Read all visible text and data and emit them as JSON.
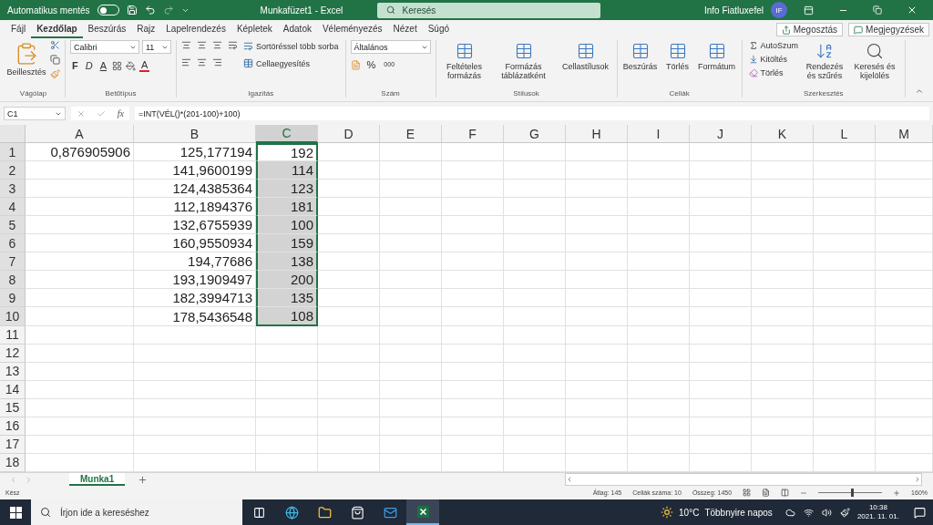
{
  "title_bar": {
    "autosave_label": "Automatikus mentés",
    "autosave_on": false,
    "file_title": "Munkafüzet1 - Excel",
    "search_placeholder": "Keresés",
    "user_name": "Info Fiatluxefel",
    "avatar_initials": "IF"
  },
  "menu_tabs": [
    {
      "label": "Fájl",
      "selected": false
    },
    {
      "label": "Kezdőlap",
      "selected": true
    },
    {
      "label": "Beszúrás",
      "selected": false
    },
    {
      "label": "Rajz",
      "selected": false
    },
    {
      "label": "Lapelrendezés",
      "selected": false
    },
    {
      "label": "Képletek",
      "selected": false
    },
    {
      "label": "Adatok",
      "selected": false
    },
    {
      "label": "Véleményezés",
      "selected": false
    },
    {
      "label": "Nézet",
      "selected": false
    },
    {
      "label": "Súgó",
      "selected": false
    }
  ],
  "share_button": "Megosztás",
  "comments_button": "Megjegyzések",
  "ribbon": {
    "clipboard": {
      "label": "Vágólap",
      "paste": "Beillesztés"
    },
    "font": {
      "label": "Betűtípus",
      "font_name": "Calibri",
      "font_size": "11",
      "bold": "F",
      "italic": "D",
      "underline": "A",
      "font_color": "A"
    },
    "alignment": {
      "label": "Igazítás",
      "wrap_text": "Sortöréssel több sorba",
      "merge": "Cellaegyesítés"
    },
    "number": {
      "label": "Szám",
      "format": "Általános",
      "percent": "%",
      "thousands": "000"
    },
    "styles": {
      "label": "Stílusok",
      "buttons": [
        "Feltételes formázás",
        "Formázás táblázatként",
        "Cellastílusok"
      ]
    },
    "cells": {
      "label": "Cellák",
      "buttons": [
        "Beszúrás",
        "Törlés",
        "Formátum"
      ]
    },
    "editing": {
      "label": "Szerkesztés",
      "autosum": "AutoSzum",
      "fill": "Kitöltés",
      "clear": "Törlés",
      "sort": "Rendezés és szűrés",
      "find": "Keresés és kijelölés"
    }
  },
  "formula_bar": {
    "name_box": "C1",
    "fx": "fx",
    "formula": "=INT(VÉL()*(201-100)+100)"
  },
  "sheet": {
    "columns": [
      {
        "label": "A",
        "selected": false
      },
      {
        "label": "B",
        "selected": false
      },
      {
        "label": "C",
        "selected": true
      },
      {
        "label": "D",
        "selected": false
      },
      {
        "label": "E",
        "selected": false
      },
      {
        "label": "F",
        "selected": false
      },
      {
        "label": "G",
        "selected": false
      },
      {
        "label": "H",
        "selected": false
      },
      {
        "label": "I",
        "selected": false
      },
      {
        "label": "J",
        "selected": false
      },
      {
        "label": "K",
        "selected": false
      },
      {
        "label": "L",
        "selected": false
      },
      {
        "label": "M",
        "selected": false
      }
    ],
    "rows": [
      {
        "label": "1",
        "selected": true,
        "cells": [
          "0,876905906",
          "125,177194",
          "192"
        ]
      },
      {
        "label": "2",
        "selected": true,
        "cells": [
          "",
          "141,9600199",
          "114"
        ]
      },
      {
        "label": "3",
        "selected": true,
        "cells": [
          "",
          "124,4385364",
          "123"
        ]
      },
      {
        "label": "4",
        "selected": true,
        "cells": [
          "",
          "112,1894376",
          "181"
        ]
      },
      {
        "label": "5",
        "selected": true,
        "cells": [
          "",
          "132,6755939",
          "100"
        ]
      },
      {
        "label": "6",
        "selected": true,
        "cells": [
          "",
          "160,9550934",
          "159"
        ]
      },
      {
        "label": "7",
        "selected": true,
        "cells": [
          "",
          "194,77686",
          "138"
        ]
      },
      {
        "label": "8",
        "selected": true,
        "cells": [
          "",
          "193,1909497",
          "200"
        ]
      },
      {
        "label": "9",
        "selected": true,
        "cells": [
          "",
          "182,3994713",
          "135"
        ]
      },
      {
        "label": "10",
        "selected": true,
        "cells": [
          "",
          "178,5436548",
          "108"
        ]
      },
      {
        "label": "11",
        "selected": false,
        "cells": []
      },
      {
        "label": "12",
        "selected": false,
        "cells": []
      },
      {
        "label": "13",
        "selected": false,
        "cells": []
      },
      {
        "label": "14",
        "selected": false,
        "cells": []
      },
      {
        "label": "15",
        "selected": false,
        "cells": []
      },
      {
        "label": "16",
        "selected": false,
        "cells": []
      },
      {
        "label": "17",
        "selected": false,
        "cells": []
      },
      {
        "label": "18",
        "selected": false,
        "cells": []
      }
    ]
  },
  "sheet_tabs": [
    {
      "label": "Munka1",
      "selected": true
    }
  ],
  "status_bar": {
    "ready": "Kész",
    "average": "Átlag: 145",
    "count": "Cellák száma: 10",
    "sum": "Összeg: 1450",
    "zoom_slider": {
      "level": 0.53
    },
    "zoom": "160%"
  },
  "taskbar": {
    "search_placeholder": "Írjon ide a kereséshez",
    "temperature": "10°C",
    "weather": "Többnyire napos",
    "time": "10:38",
    "date": "2021. 11. 01."
  }
}
